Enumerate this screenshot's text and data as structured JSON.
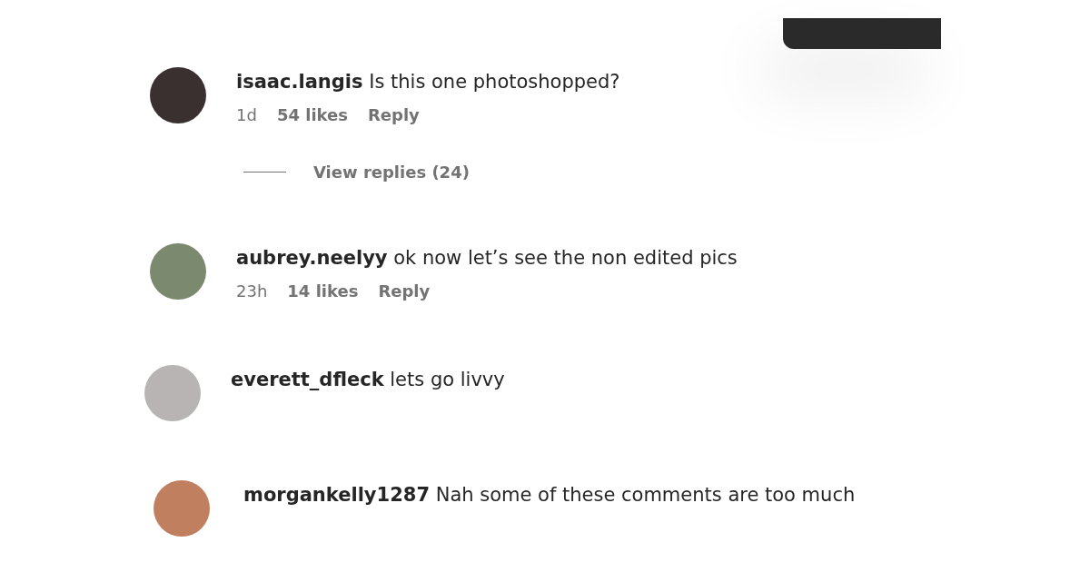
{
  "comments": [
    {
      "username": "isaac.langis",
      "text": "Is this one photoshopped?",
      "time": "1d",
      "likes": "54 likes",
      "reply": "Reply",
      "view_replies": "View replies (24)"
    },
    {
      "username": "aubrey.neelyy",
      "text": "ok now let’s see the non edited pics",
      "time": "23h",
      "likes": "14 likes",
      "reply": "Reply"
    },
    {
      "username": "everett_dfleck",
      "text": "lets go livvy"
    },
    {
      "username": "morgankelly1287",
      "text": "Nah some of these comments are too much"
    }
  ]
}
